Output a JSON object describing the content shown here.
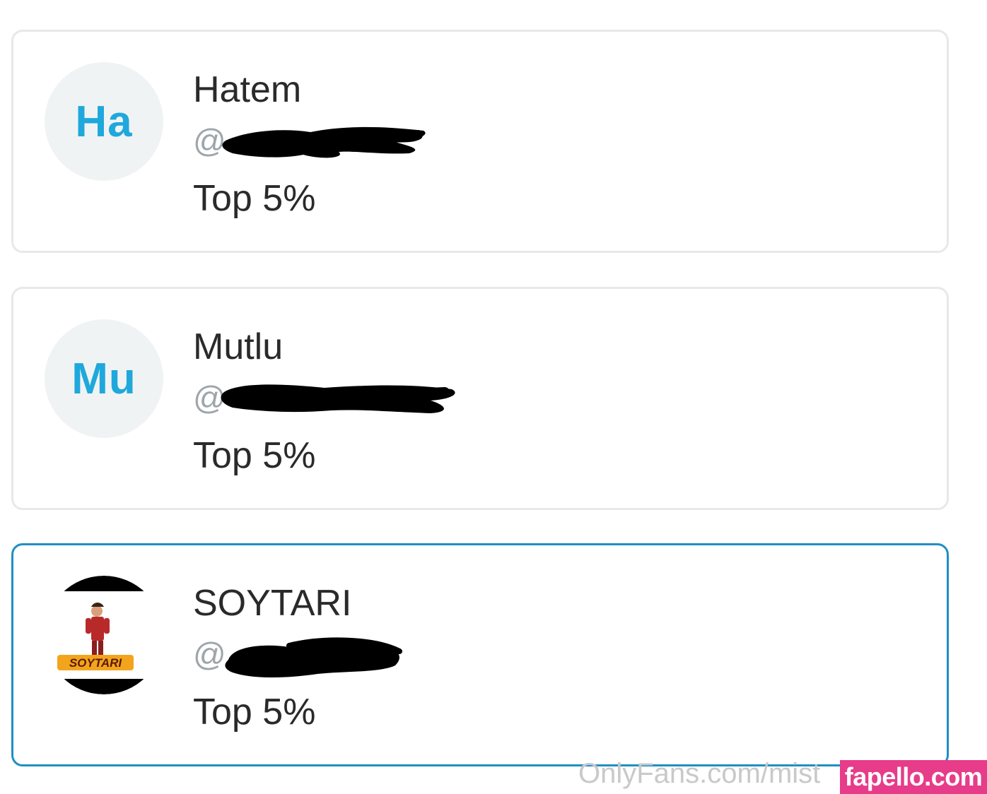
{
  "cards": [
    {
      "initials": "Ha",
      "name": "Hatem",
      "handle_prefix": "@",
      "rank": "Top 5%",
      "selected": false
    },
    {
      "initials": "Mu",
      "name": "Mutlu",
      "handle_prefix": "@",
      "rank": "Top 5%",
      "selected": false
    },
    {
      "avatar_logo_text": "SOYTARI",
      "name": "SOYTARI",
      "handle_prefix": "@",
      "rank": "Top 5%",
      "selected": true
    }
  ],
  "colors": {
    "accent": "#1fa8dc",
    "selected_border": "#1f8fc4",
    "card_border": "#e6e8ea",
    "text": "#2a2a2a",
    "muted": "#9ea6ab",
    "watermark_badge": "#e63c8a"
  },
  "watermark": {
    "site_text": "OnlyFans.com/mist",
    "badge_text": "fapello.com"
  }
}
